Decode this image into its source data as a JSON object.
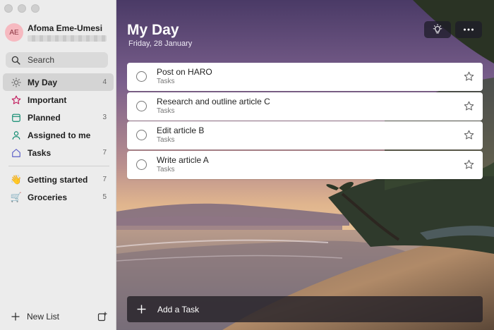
{
  "user": {
    "initials": "AE",
    "name": "Afoma Eme-Umesi"
  },
  "search": {
    "label": "Search"
  },
  "nav": [
    {
      "label": "My Day",
      "count": "4",
      "icon": "sun-icon",
      "color": "#6b6b6b"
    },
    {
      "label": "Important",
      "count": "",
      "icon": "star-icon",
      "color": "#c2185b"
    },
    {
      "label": "Planned",
      "count": "3",
      "icon": "calendar-icon",
      "color": "#0d8a6e"
    },
    {
      "label": "Assigned to me",
      "count": "",
      "icon": "person-icon",
      "color": "#0d8a6e"
    },
    {
      "label": "Tasks",
      "count": "7",
      "icon": "home-icon",
      "color": "#5b5fc7"
    }
  ],
  "lists": [
    {
      "label": "Getting started",
      "count": "7",
      "emoji": "👋"
    },
    {
      "label": "Groceries",
      "count": "5",
      "emoji": "🛒"
    }
  ],
  "new_list": {
    "label": "New List"
  },
  "main": {
    "title": "My Day",
    "date": "Friday, 28 January"
  },
  "tasks": [
    {
      "title": "Post on HARO",
      "list": "Tasks"
    },
    {
      "title": "Research and outline article C",
      "list": "Tasks"
    },
    {
      "title": "Edit article B",
      "list": "Tasks"
    },
    {
      "title": "Write article A",
      "list": "Tasks"
    }
  ],
  "add_task": {
    "label": "Add a Task"
  }
}
